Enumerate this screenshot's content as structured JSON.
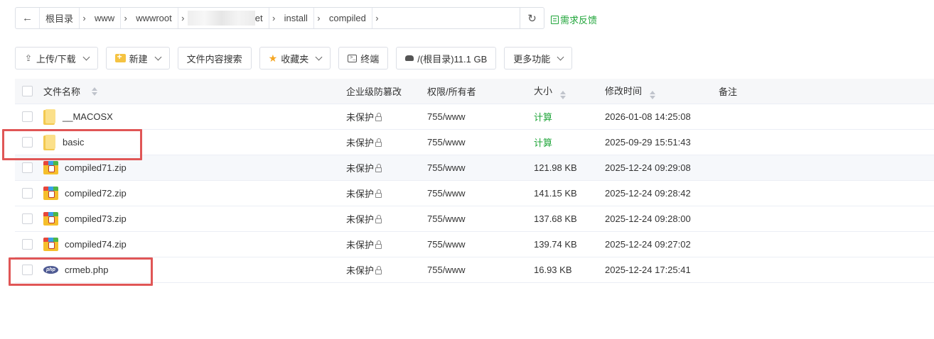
{
  "breadcrumb": {
    "items": [
      "根目录",
      "www",
      "wwwroot",
      "",
      "et",
      "install",
      "compiled"
    ]
  },
  "feedback": {
    "label": "需求反馈"
  },
  "toolbar": {
    "upload": "上传/下载",
    "new": "新建",
    "search": "文件内容搜索",
    "favorites": "收藏夹",
    "terminal": "终端",
    "disk": "/(根目录)11.1 GB",
    "more": "更多功能"
  },
  "table": {
    "headers": {
      "name": "文件名称",
      "protection": "企业级防篡改",
      "permission": "权限/所有者",
      "size": "大小",
      "mtime": "修改时间",
      "note": "备注"
    },
    "rows": [
      {
        "name": "__MACOSX",
        "type": "folder",
        "protection": "未保护",
        "permission": "755/www",
        "size": "计算",
        "mtime": "2026-01-08 14:25:08"
      },
      {
        "name": "basic",
        "type": "folder",
        "protection": "未保护",
        "permission": "755/www",
        "size": "计算",
        "mtime": "2025-09-29 15:51:43"
      },
      {
        "name": "compiled71.zip",
        "type": "zip",
        "protection": "未保护",
        "permission": "755/www",
        "size": "121.98 KB",
        "mtime": "2025-12-24 09:29:08"
      },
      {
        "name": "compiled72.zip",
        "type": "zip",
        "protection": "未保护",
        "permission": "755/www",
        "size": "141.15 KB",
        "mtime": "2025-12-24 09:28:42"
      },
      {
        "name": "compiled73.zip",
        "type": "zip",
        "protection": "未保护",
        "permission": "755/www",
        "size": "137.68 KB",
        "mtime": "2025-12-24 09:28:00"
      },
      {
        "name": "compiled74.zip",
        "type": "zip",
        "protection": "未保护",
        "permission": "755/www",
        "size": "139.74 KB",
        "mtime": "2025-12-24 09:27:02"
      },
      {
        "name": "crmeb.php",
        "type": "php",
        "protection": "未保护",
        "permission": "755/www",
        "size": "16.93 KB",
        "mtime": "2025-12-24 17:25:41"
      }
    ],
    "php_icon_text": "php"
  },
  "colors": {
    "accent": "#20a53a",
    "highlight": "#e05656"
  }
}
